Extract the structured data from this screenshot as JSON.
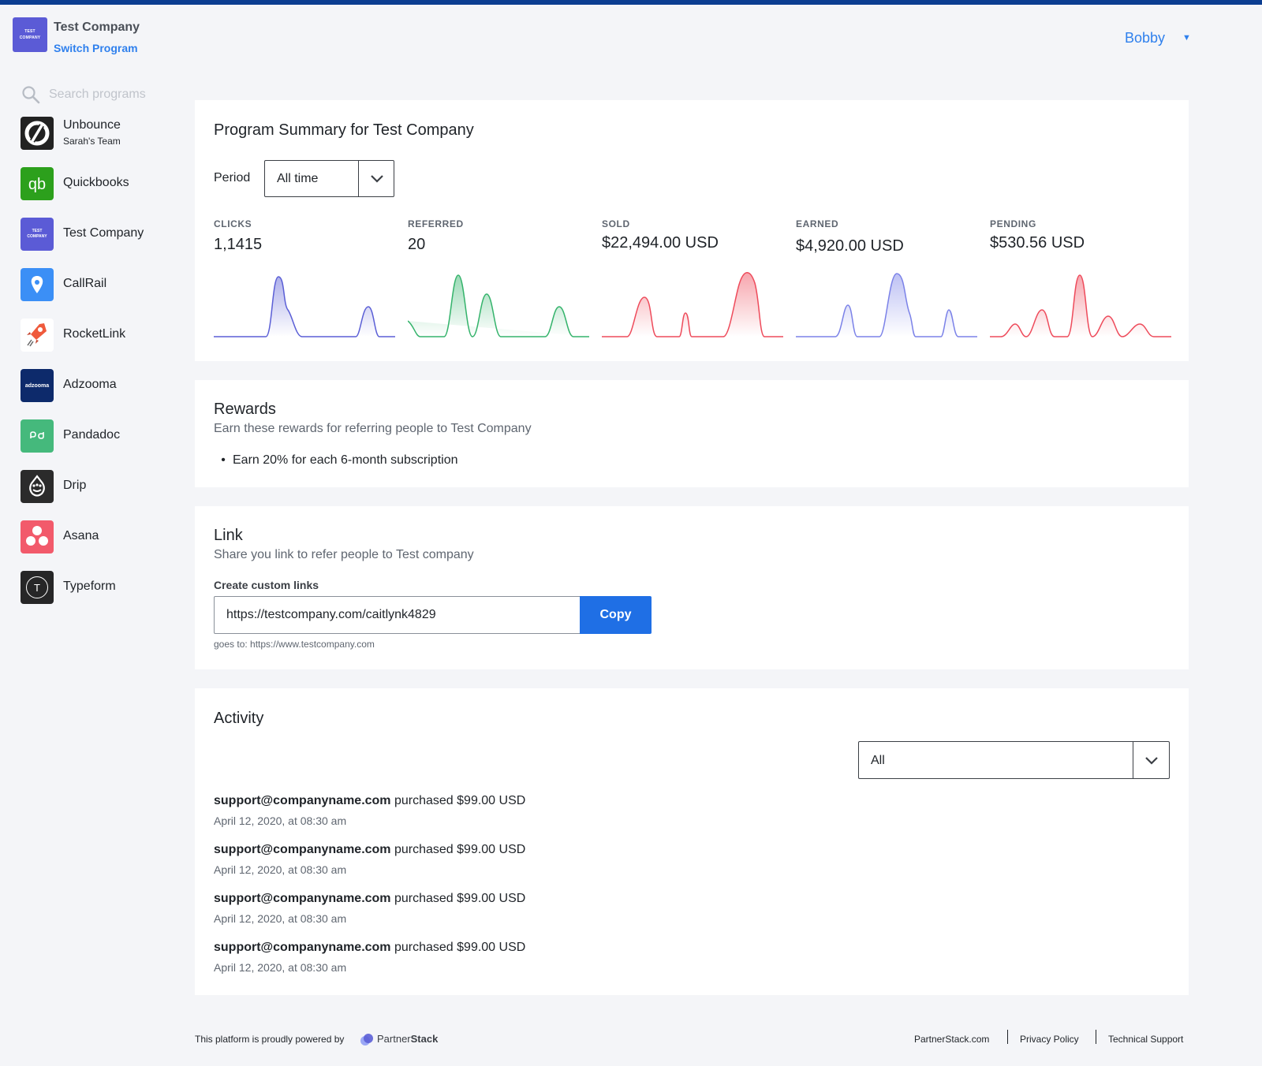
{
  "header": {
    "company_logo_text": "TEST COMPANY",
    "company_name": "Test Company",
    "switch_program": "Switch Program",
    "user_name": "Bobby",
    "user_caret": "▼"
  },
  "sidebar": {
    "search_placeholder": "Search programs",
    "programs": [
      {
        "name": "Unbounce",
        "subtitle": "Sarah's Team",
        "icon": "unbounce-icon",
        "color": "#222222"
      },
      {
        "name": "Quickbooks",
        "icon": "quickbooks-icon",
        "color": "#2ca01c"
      },
      {
        "name": "Test Company",
        "icon": "test-company-icon",
        "color": "#5b5bd6"
      },
      {
        "name": "CallRail",
        "icon": "callrail-icon",
        "color": "#3b8ff6"
      },
      {
        "name": "RocketLink",
        "icon": "rocketlink-icon",
        "color": "#ffffff"
      },
      {
        "name": "Adzooma",
        "icon": "adzooma-icon",
        "color": "#0d2a6b"
      },
      {
        "name": "Pandadoc",
        "icon": "pandadoc-icon",
        "color": "#45b97c"
      },
      {
        "name": "Drip",
        "icon": "drip-icon",
        "color": "#2b2b2b"
      },
      {
        "name": "Asana",
        "icon": "asana-icon",
        "color": "#f25a6b"
      },
      {
        "name": "Typeform",
        "icon": "typeform-icon",
        "color": "#262627"
      }
    ],
    "adzooma_logo_text": "adzooma",
    "typeform_logo_text": "T"
  },
  "summary": {
    "title": "Program Summary for Test Company",
    "period_label": "Period",
    "period_value": "All time",
    "metrics": [
      {
        "label": "CLICKS",
        "value": "1,1415",
        "color": "#5b5fd6"
      },
      {
        "label": "REFERRED",
        "value": "20",
        "color": "#34b36b"
      },
      {
        "label": "SOLD",
        "value": "$22,494.00 USD",
        "color": "#ee4b5b"
      },
      {
        "label": "EARNED",
        "value": "$4,920.00 USD",
        "color": "#7b82e8"
      },
      {
        "label": "PENDING",
        "value": "$530.56 USD",
        "color": "#ee4b5b"
      }
    ]
  },
  "rewards": {
    "title": "Rewards",
    "subtitle": "Earn these rewards for referring people to Test Company",
    "bullet": "•",
    "items": [
      "Earn 20% for each 6-month subscription"
    ]
  },
  "link": {
    "title": "Link",
    "subtitle": "Share you link to refer people to Test company",
    "custom_links_label": "Create custom links",
    "url": "https://testcompany.com/caitlynk4829",
    "copy_label": "Copy",
    "goes_to": "goes to: https://www.testcompany.com"
  },
  "activity": {
    "title": "Activity",
    "filter_value": "All",
    "items": [
      {
        "email": "support@companyname.com",
        "action": " purchased $99.00 USD",
        "date": "April 12, 2020, at 08:30 am"
      },
      {
        "email": "support@companyname.com",
        "action": " purchased $99.00 USD",
        "date": "April 12, 2020, at 08:30 am"
      },
      {
        "email": "support@companyname.com",
        "action": " purchased $99.00 USD",
        "date": "April 12, 2020, at 08:30 am"
      },
      {
        "email": "support@companyname.com",
        "action": " purchased $99.00 USD",
        "date": "April 12, 2020, at 08:30 am"
      }
    ]
  },
  "footer": {
    "powered_by": "This platform is proudly powered by",
    "brand_light": "Partner",
    "brand_bold": "Stack",
    "links": [
      "PartnerStack.com",
      "Privacy Policy",
      "Technical Support"
    ]
  }
}
